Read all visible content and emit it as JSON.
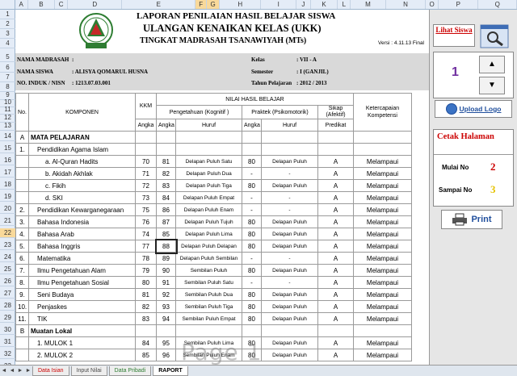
{
  "columns": [
    "A",
    "B",
    "C",
    "D",
    "E",
    "F",
    "G",
    "H",
    "I",
    "J",
    "K",
    "L",
    "M",
    "N",
    "O",
    "P",
    "Q"
  ],
  "rows": [
    "1",
    "2",
    "3",
    "4",
    "5",
    "6",
    "7",
    "8",
    "9",
    "10",
    "11",
    "12",
    "13",
    "14",
    "15",
    "16",
    "17",
    "18",
    "19",
    "20",
    "21",
    "22",
    "23",
    "24",
    "25",
    "26",
    "27",
    "28",
    "29",
    "30",
    "31",
    "32",
    "33",
    "34",
    "35",
    "36"
  ],
  "header": {
    "title1": "LAPORAN PENILAIAN HASIL BELAJAR SISWA",
    "title2": "ULANGAN KENAIKAN KELAS (UKK)",
    "title3": "TINGKAT MADRASAH TSANAWIYAH (MTs)",
    "version": "Versi : 4.11.13 Final"
  },
  "student": {
    "nama_madrasah_label": "NAMA MADRASAH",
    "nama_madrasah_value": ":",
    "nama_siswa_label": "NAMA SISWA",
    "nama_siswa_value": ": ALISYA QOMARUL HUSNA",
    "induk_label": "NO. INDUK / NISN",
    "induk_value": ": 1213.07.03.001",
    "kelas_label": "Kelas",
    "kelas_value": ": VII - A",
    "semester_label": "Semester",
    "semester_value": ": I (GANJIL)",
    "tahun_label": "Tahun Pelajaran",
    "tahun_value": ": 2012 / 2013"
  },
  "table_header": {
    "nilai": "NILAI HASIL BELAJAR",
    "no": "No.",
    "komponen": "KOMPONEN",
    "kkm": "KKM",
    "pengetahuan": "Pengetahuan (Kognitif )",
    "praktek": "Praktek (Psikomotorik)",
    "sikap": "Sikap (Afektif)",
    "ketercapaian": "Ketercapaian Kompetensi",
    "angka1": "Angka",
    "angka2": "Angka",
    "huruf1": "Huruf",
    "angka3": "Angka",
    "huruf2": "Huruf",
    "predikat": "Predikat"
  },
  "rows_data": [
    {
      "no": "A",
      "komponen": "MATA PELAJARAN",
      "bold": true,
      "level": 0
    },
    {
      "no": "1.",
      "komponen": "Pendidikan Agama Islam",
      "level": 1
    },
    {
      "no": "",
      "komponen": "a. Al-Quran Hadits",
      "level": 2,
      "kkm": "70",
      "ang": "81",
      "huruf": "Delapan Puluh Satu",
      "pang": "80",
      "phuruf": "Delapan Puluh",
      "sikap": "A",
      "ket": "Melampaui"
    },
    {
      "no": "",
      "komponen": "b. Akidah Akhlak",
      "level": 2,
      "kkm": "71",
      "ang": "82",
      "huruf": "Delapan Puluh Dua",
      "pang": "-",
      "phuruf": "-",
      "sikap": "A",
      "ket": "Melampaui"
    },
    {
      "no": "",
      "komponen": "c. Fikih",
      "level": 2,
      "kkm": "72",
      "ang": "83",
      "huruf": "Delapan Puluh Tiga",
      "pang": "80",
      "phuruf": "Delapan Puluh",
      "sikap": "A",
      "ket": "Melampaui"
    },
    {
      "no": "",
      "komponen": "d. SKI",
      "level": 2,
      "kkm": "73",
      "ang": "84",
      "huruf": "Delapan Puluh Empat",
      "pang": "-",
      "phuruf": "-",
      "sikap": "A",
      "ket": "Melampaui"
    },
    {
      "no": "2.",
      "komponen": "Pendidikan Kewarganegaraan",
      "level": 1,
      "kkm": "75",
      "ang": "86",
      "huruf": "Delapan Puluh Enam",
      "pang": "-",
      "phuruf": "-",
      "sikap": "A",
      "ket": "Melampaui"
    },
    {
      "no": "3.",
      "komponen": "Bahasa Indonesia",
      "level": 1,
      "kkm": "76",
      "ang": "87",
      "huruf": "Delapan Puluh Tujuh",
      "pang": "80",
      "phuruf": "Delapan Puluh",
      "sikap": "A",
      "ket": "Melampaui"
    },
    {
      "no": "4.",
      "komponen": "Bahasa Arab",
      "level": 1,
      "kkm": "74",
      "ang": "85",
      "huruf": "Delapan Puluh Lima",
      "pang": "80",
      "phuruf": "Delapan Puluh",
      "sikap": "A",
      "ket": "Melampaui"
    },
    {
      "no": "5.",
      "komponen": "Bahasa Inggris",
      "level": 1,
      "kkm": "77",
      "ang": "88",
      "huruf": "Delapan Puluh Delapan",
      "pang": "80",
      "phuruf": "Delapan Puluh",
      "sikap": "A",
      "ket": "Melampaui",
      "boxed": true
    },
    {
      "no": "6.",
      "komponen": "Matematika",
      "level": 1,
      "kkm": "78",
      "ang": "89",
      "huruf": "Delapan Puluh Sembilan",
      "pang": "-",
      "phuruf": "-",
      "sikap": "A",
      "ket": "Melampaui"
    },
    {
      "no": "7.",
      "komponen": "Ilmu Pengetahuan Alam",
      "level": 1,
      "kkm": "79",
      "ang": "90",
      "huruf": "Sembilan Puluh",
      "pang": "80",
      "phuruf": "Delapan Puluh",
      "sikap": "A",
      "ket": "Melampaui"
    },
    {
      "no": "8.",
      "komponen": "Ilmu Pengetahuan Sosial",
      "level": 1,
      "kkm": "80",
      "ang": "91",
      "huruf": "Sembilan Puluh Satu",
      "pang": "-",
      "phuruf": "-",
      "sikap": "A",
      "ket": "Melampaui"
    },
    {
      "no": "9.",
      "komponen": "Seni Budaya",
      "level": 1,
      "kkm": "81",
      "ang": "92",
      "huruf": "Sembilan Puluh Dua",
      "pang": "80",
      "phuruf": "Delapan Puluh",
      "sikap": "A",
      "ket": "Melampaui"
    },
    {
      "no": "10.",
      "komponen": "Penjaskes",
      "level": 1,
      "kkm": "82",
      "ang": "93",
      "huruf": "Sembilan Puluh Tiga",
      "pang": "80",
      "phuruf": "Delapan Puluh",
      "sikap": "A",
      "ket": "Melampaui"
    },
    {
      "no": "11.",
      "komponen": "TIK",
      "level": 1,
      "kkm": "83",
      "ang": "94",
      "huruf": "Sembilan Puluh Empat",
      "pang": "80",
      "phuruf": "Delapan Puluh",
      "sikap": "A",
      "ket": "Melampaui"
    },
    {
      "no": "B",
      "komponen": "Muatan Lokal",
      "bold": true,
      "level": 0
    },
    {
      "no": "",
      "komponen": "1. MULOK 1",
      "level": 1,
      "kkm": "84",
      "ang": "95",
      "huruf": "Sembilan Puluh Lima",
      "pang": "80",
      "phuruf": "Delapan Puluh",
      "sikap": "A",
      "ket": "Melampaui"
    },
    {
      "no": "",
      "komponen": "2. MULOK 2",
      "level": 1,
      "kkm": "85",
      "ang": "96",
      "huruf": "Sembilan Puluh Enam",
      "pang": "80",
      "phuruf": "Delapan Puluh",
      "sikap": "A",
      "ket": "Melampaui"
    }
  ],
  "watermark": "Page 1",
  "panel": {
    "lihat_siswa": "Lihat Siswa",
    "current_no": "1",
    "upload_logo": "Upload Logo",
    "cetak_halaman": "Cetak Halaman",
    "mulai_label": "Mulai No",
    "mulai_value": "2",
    "sampai_label": "Sampai No",
    "sampai_value": "3",
    "print": "Print"
  },
  "tabs": [
    "Data Isian",
    "Input Nilai",
    "Data Pribadi",
    "RAPORT"
  ],
  "colors": {
    "accent_red": "#cc0000",
    "selected_header": "#f9d99a",
    "upload_blue": "#1f4e9c"
  }
}
